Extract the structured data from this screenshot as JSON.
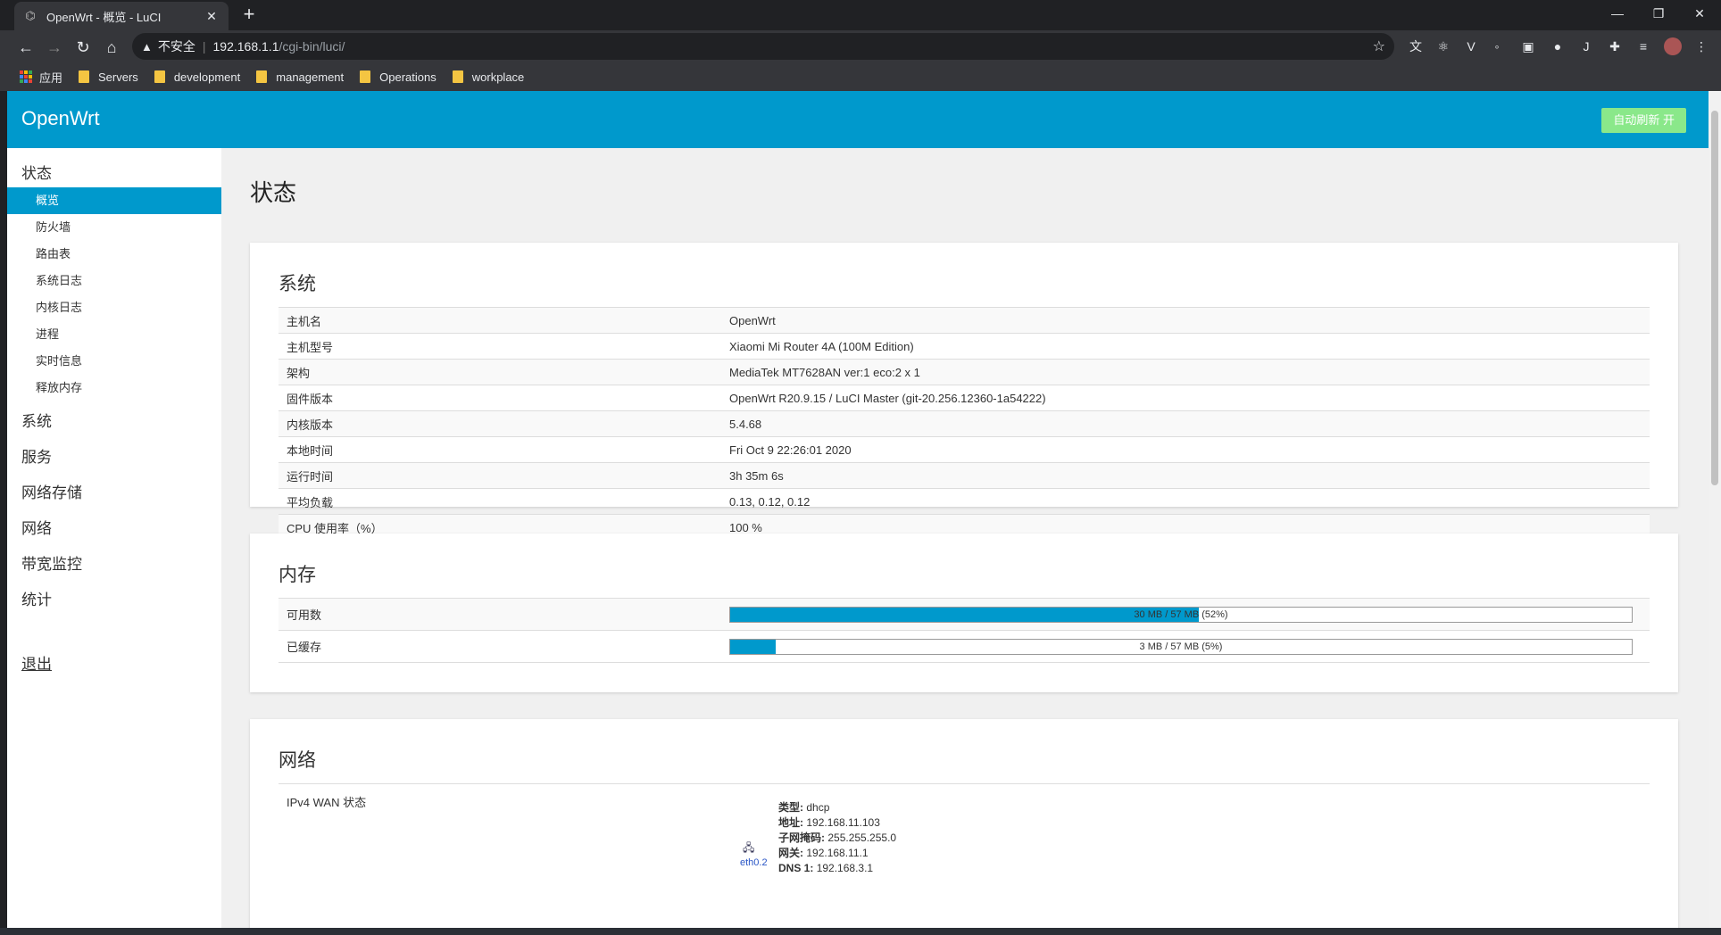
{
  "browser": {
    "tab_title": "OpenWrt - 概览 - LuCI",
    "address_insecure": "不安全",
    "address_host": "192.168.1.1",
    "address_path": "/cgi-bin/luci/",
    "bookmarks": [
      "应用",
      "Servers",
      "development",
      "management",
      "Operations",
      "workplace"
    ]
  },
  "header": {
    "brand": "OpenWrt",
    "auto_refresh": "自动刷新 开"
  },
  "sidebar": {
    "status": "状态",
    "status_items": [
      "概览",
      "防火墙",
      "路由表",
      "系统日志",
      "内核日志",
      "进程",
      "实时信息",
      "释放内存"
    ],
    "menus": [
      "系统",
      "服务",
      "网络存储",
      "网络",
      "带宽监控",
      "统计"
    ],
    "logout": "退出"
  },
  "main": {
    "title": "状态",
    "system": {
      "title": "系统",
      "rows": [
        {
          "k": "主机名",
          "v": "OpenWrt"
        },
        {
          "k": "主机型号",
          "v": "Xiaomi Mi Router 4A (100M Edition)"
        },
        {
          "k": "架构",
          "v": "MediaTek MT7628AN ver:1 eco:2 x 1"
        },
        {
          "k": "固件版本",
          "v": "OpenWrt R20.9.15 / LuCI Master (git-20.256.12360-1a54222)"
        },
        {
          "k": "内核版本",
          "v": "5.4.68"
        },
        {
          "k": "本地时间",
          "v": "Fri Oct 9 22:26:01 2020"
        },
        {
          "k": "运行时间",
          "v": "3h 35m 6s"
        },
        {
          "k": "平均负载",
          "v": "0.13, 0.12, 0.12"
        },
        {
          "k": "CPU 使用率（%）",
          "v": "100 %"
        }
      ]
    },
    "memory": {
      "title": "内存",
      "rows": [
        {
          "k": "可用数",
          "text": "30 MB / 57 MB (52%)",
          "percent": 52
        },
        {
          "k": "已缓存",
          "text": "3 MB / 57 MB (5%)",
          "percent": 5
        }
      ]
    },
    "network": {
      "title": "网络",
      "wan_label": "IPv4 WAN 状态",
      "interface": "eth0.2",
      "info": [
        {
          "k": "类型:",
          "v": "dhcp"
        },
        {
          "k": "地址:",
          "v": "192.168.11.103"
        },
        {
          "k": "子网掩码:",
          "v": "255.255.255.0"
        },
        {
          "k": "网关:",
          "v": "192.168.11.1"
        },
        {
          "k": "DNS 1:",
          "v": "192.168.3.1"
        }
      ]
    }
  },
  "colors": {
    "header": "#0099cc",
    "accent": "#0099cc",
    "refresh_button": "#8ae88a"
  }
}
